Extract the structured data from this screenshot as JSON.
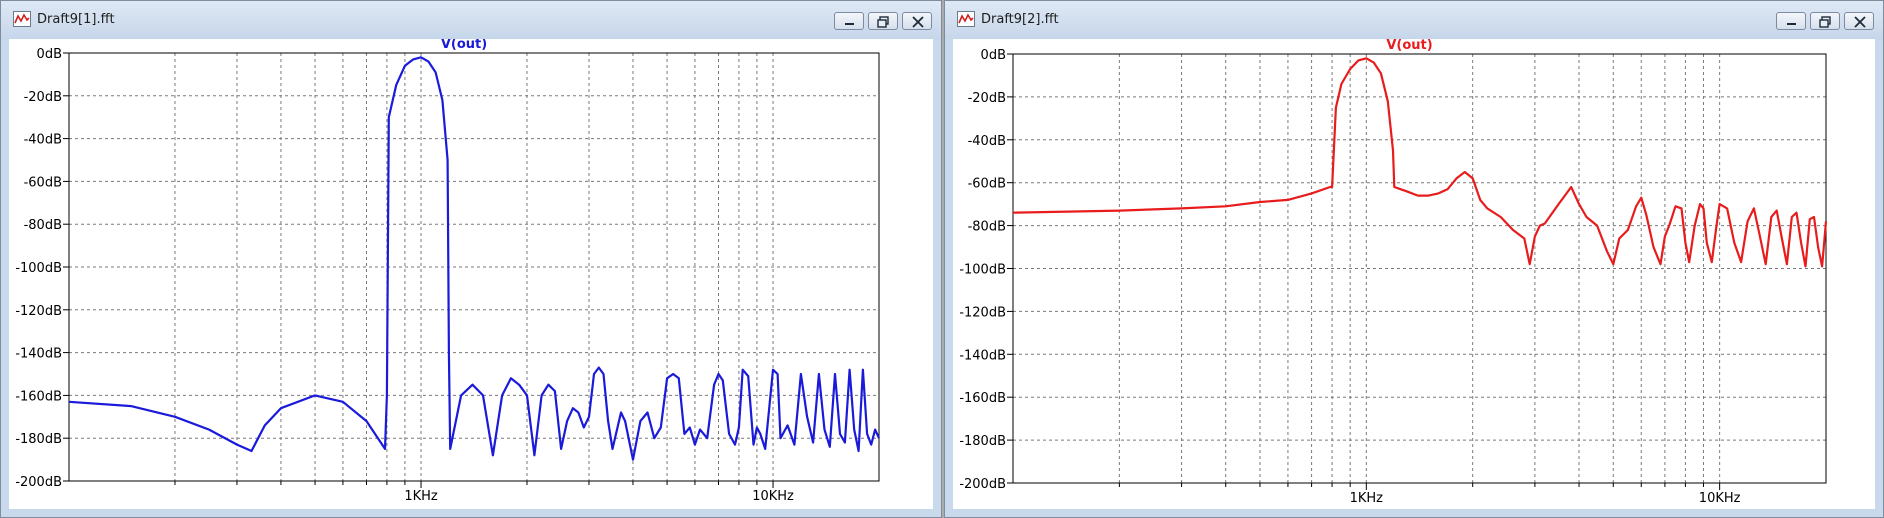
{
  "windows": [
    {
      "title": "Draft9[1].fft",
      "trace_color": "#1a1adb",
      "chart_data": {
        "type": "line",
        "title": "V(out)",
        "xlabel": "",
        "ylabel": "",
        "x_scale": "log",
        "xlim": [
          100,
          20000
        ],
        "ylim": [
          -200,
          0
        ],
        "x_tick_labels": [
          {
            "value": 1000,
            "label": "1KHz"
          },
          {
            "value": 10000,
            "label": "10KHz"
          }
        ],
        "y_tick_labels": [
          "0dB",
          "-20dB",
          "-40dB",
          "-60dB",
          "-80dB",
          "-100dB",
          "-120dB",
          "-140dB",
          "-160dB",
          "-180dB",
          "-200dB"
        ],
        "grid": true,
        "series": [
          {
            "name": "V(out)",
            "x": [
              100,
              150,
              200,
              250,
              300,
              330,
              360,
              400,
              500,
              600,
              700,
              790,
              800,
              810,
              850,
              900,
              950,
              1000,
              1050,
              1100,
              1150,
              1190,
              1200,
              1210,
              1300,
              1400,
              1500,
              1600,
              1700,
              1800,
              1900,
              2000,
              2100,
              2200,
              2300,
              2400,
              2500,
              2600,
              2700,
              2800,
              2900,
              3000,
              3100,
              3200,
              3300,
              3400,
              3500,
              3700,
              3800,
              4000,
              4200,
              4400,
              4600,
              4800,
              5000,
              5200,
              5400,
              5600,
              5800,
              6000,
              6200,
              6500,
              6800,
              7000,
              7200,
              7500,
              7800,
              8000,
              8200,
              8500,
              8800,
              9000,
              9200,
              9500,
              10000,
              10300,
              10500,
              11000,
              11500,
              12000,
              12500,
              13000,
              13500,
              14000,
              14500,
              15000,
              15500,
              16000,
              16500,
              17000,
              17500,
              18000,
              18500,
              19000,
              19500,
              20000
            ],
            "y": [
              -163,
              -165,
              -170,
              -176,
              -183,
              -186,
              -174,
              -166,
              -160,
              -163,
              -172,
              -185,
              -160,
              -30,
              -15,
              -6,
              -3,
              -2,
              -4,
              -9,
              -22,
              -50,
              -140,
              -185,
              -160,
              -155,
              -160,
              -188,
              -160,
              -152,
              -155,
              -160,
              -188,
              -160,
              -155,
              -158,
              -185,
              -172,
              -166,
              -168,
              -175,
              -170,
              -150,
              -147,
              -150,
              -172,
              -185,
              -168,
              -172,
              -190,
              -172,
              -168,
              -180,
              -175,
              -152,
              -150,
              -152,
              -178,
              -175,
              -183,
              -176,
              -180,
              -155,
              -150,
              -153,
              -178,
              -183,
              -175,
              -148,
              -151,
              -183,
              -175,
              -178,
              -185,
              -148,
              -150,
              -180,
              -174,
              -183,
              -150,
              -170,
              -182,
              -150,
              -176,
              -184,
              -150,
              -178,
              -182,
              -148,
              -176,
              -186,
              -148,
              -178,
              -183,
              -176,
              -180
            ]
          }
        ]
      }
    },
    {
      "title": "Draft9[2].fft",
      "trace_color": "#e81c1c",
      "chart_data": {
        "type": "line",
        "title": "V(out)",
        "xlabel": "",
        "ylabel": "",
        "x_scale": "log",
        "xlim": [
          100,
          20000
        ],
        "ylim": [
          -200,
          0
        ],
        "x_tick_labels": [
          {
            "value": 1000,
            "label": "1KHz"
          },
          {
            "value": 10000,
            "label": "10KHz"
          }
        ],
        "y_tick_labels": [
          "0dB",
          "-20dB",
          "-40dB",
          "-60dB",
          "-80dB",
          "-100dB",
          "-120dB",
          "-140dB",
          "-160dB",
          "-180dB",
          "-200dB"
        ],
        "grid": true,
        "series": [
          {
            "name": "V(out)",
            "x": [
              100,
              200,
              300,
              400,
              500,
              600,
              700,
              790,
              800,
              820,
              850,
              900,
              950,
              1000,
              1050,
              1100,
              1150,
              1190,
              1200,
              1300,
              1400,
              1500,
              1600,
              1700,
              1800,
              1900,
              2000,
              2100,
              2200,
              2400,
              2600,
              2800,
              2900,
              3000,
              3100,
              3200,
              3500,
              3800,
              4000,
              4200,
              4500,
              4800,
              5000,
              5200,
              5500,
              5800,
              6000,
              6200,
              6500,
              6800,
              7000,
              7200,
              7500,
              7800,
              8000,
              8200,
              8500,
              8800,
              9000,
              9200,
              9500,
              9800,
              10000,
              10500,
              11000,
              11500,
              12000,
              12500,
              13000,
              13500,
              14000,
              14500,
              15000,
              15500,
              16000,
              16500,
              17000,
              17500,
              18000,
              18500,
              19000,
              19500,
              20000
            ],
            "y": [
              -74,
              -73,
              -72,
              -71,
              -69,
              -68,
              -65,
              -62,
              -62,
              -25,
              -14,
              -7,
              -3,
              -2,
              -4,
              -9,
              -22,
              -45,
              -62,
              -64,
              -66,
              -66,
              -65,
              -63,
              -58,
              -55,
              -58,
              -68,
              -72,
              -76,
              -82,
              -86,
              -98,
              -85,
              -80,
              -79,
              -70,
              -62,
              -70,
              -76,
              -80,
              -92,
              -98,
              -86,
              -82,
              -71,
              -67,
              -75,
              -90,
              -98,
              -85,
              -80,
              -71,
              -72,
              -88,
              -97,
              -80,
              -70,
              -72,
              -88,
              -97,
              -80,
              -70,
              -72,
              -88,
              -97,
              -78,
              -72,
              -85,
              -98,
              -76,
              -73,
              -86,
              -98,
              -76,
              -74,
              -88,
              -99,
              -77,
              -76,
              -90,
              -99,
              -78
            ]
          }
        ]
      }
    }
  ]
}
